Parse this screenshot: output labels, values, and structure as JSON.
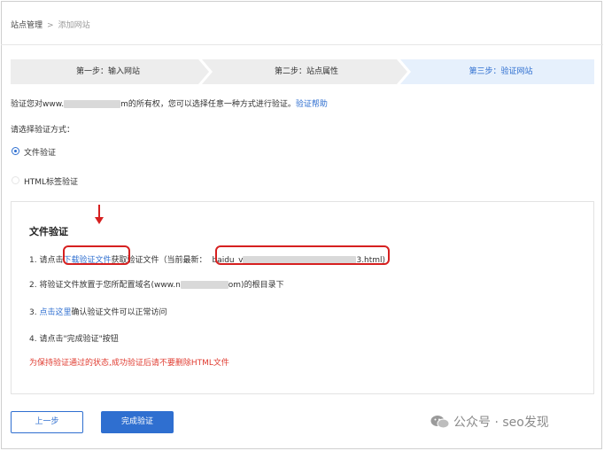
{
  "breadcrumb": {
    "root": "站点管理",
    "separator": ">",
    "current": "添加网站"
  },
  "steps": [
    {
      "label": "第一步：输入网站"
    },
    {
      "label": "第二步：站点属性"
    },
    {
      "label": "第三步：验证网站"
    }
  ],
  "colors": {
    "accent": "#2f6fd0",
    "step_inactive": "#ededed",
    "step_active": "#e6f0fc",
    "warning": "#e03c31",
    "highlight": "#d62020"
  },
  "intro": {
    "before": "验证您对www.",
    "after": "m的所有权，您可以选择任意一种方式进行验证。",
    "help_link": "验证帮助"
  },
  "choose_label": "请选择验证方式：",
  "options": [
    {
      "label": "文件验证",
      "checked": true
    },
    {
      "label": "HTML标签验证",
      "checked": false
    }
  ],
  "panel": {
    "title": "文件验证",
    "step1": {
      "num": "1. 请点击",
      "link": "下载验证文件",
      "mid": "获取验证文件（当前最新：",
      "file_start": "baidu_v",
      "file_end": "3.html)"
    },
    "step2": {
      "before": "2. 将验证文件放置于您所配置域名(www.n",
      "after": "om)的根目录下"
    },
    "step3": {
      "link": "点击这里",
      "prefix": "3. ",
      "after": "确认验证文件可以正常访问"
    },
    "step4": "4. 请点击\"完成验证\"按钮",
    "warning": "为保持验证通过的状态,成功验证后请不要删除HTML文件"
  },
  "buttons": {
    "prev": "上一步",
    "done": "完成验证"
  },
  "watermark": {
    "text": "公众号 · seo发现",
    "icon": "wechat-icon"
  }
}
